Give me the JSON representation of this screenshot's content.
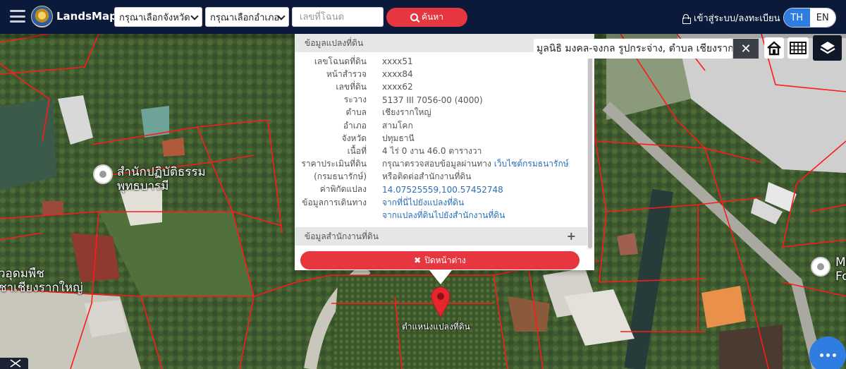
{
  "navbar": {
    "brand": "LandsMaps",
    "province_select": "กรุณาเลือกจังหวัด",
    "district_select": "กรุณาเลือกอำเภอ",
    "deed_placeholder": "เลขที่โฉนด",
    "search_label": "ค้นหา",
    "login_label": "เข้าสู่ระบบ/ลงทะเบียน",
    "lang_th": "TH",
    "lang_en": "EN"
  },
  "popup": {
    "header": "ข้อมูลแปลงที่ดิน",
    "rows": [
      {
        "label": "เลขโฉนดที่ดิน",
        "value": "xxxx51"
      },
      {
        "label": "หน้าสำรวจ",
        "value": "xxxx84"
      },
      {
        "label": "เลขที่ดิน",
        "value": "xxxx62"
      },
      {
        "label": "ระวาง",
        "value": "5137 III 7056-00 (4000)"
      },
      {
        "label": "ตำบล",
        "value": "เชียงรากใหญ่"
      },
      {
        "label": "อำเภอ",
        "value": "สามโคก"
      },
      {
        "label": "จังหวัด",
        "value": "ปทุมธานี"
      },
      {
        "label": "เนื้อที่",
        "value": "4 ไร่ 0 งาน 46.0 ตารางวา"
      }
    ],
    "appraisal_label": "ราคาประเมินที่ดิน",
    "appraisal_value": "กรุณาตรวจสอบข้อมูลผ่านทาง ",
    "appraisal_link": "เว็บไซต์กรมธนารักษ์",
    "treasury_label": "(กรมธนารักษ์)",
    "treasury_value": "หรือติดต่อสำนักงานที่ดิน",
    "coord_label": "ค่าพิกัดแปลง",
    "coord_value": "14.07525559,100.57452748",
    "travel_label": "ข้อมูลการเดินทาง",
    "travel_link_1": "จากที่นี่ไปยังแปลงที่ดิน",
    "travel_link_2": "จากแปลงที่ดินไปยังสำนักงานที่ดิน",
    "office_header": "ข้อมูลสำนักงานที่ดิน",
    "close_label": "ปิดหน้าต่าง"
  },
  "map": {
    "address_box": "มูลนิธิ มงคล-จงกล รูปกระจ่าง, ตำบล เชียงราก",
    "marker_label": "ตำแหน่งแปลงที่ดิน",
    "poi_1": {
      "line1": "สำนักปฏิบัติธรรม",
      "line2": "พุทธบารมี"
    },
    "poi_2": {
      "line1": "วอุดมพืช",
      "line2": "ชาเชียงรากใหญ่"
    },
    "poi_3": {
      "line1": "M",
      "line2": "Fo"
    }
  },
  "colors": {
    "navbar_bg": "#0b1a3a",
    "accent_red": "#e6363f",
    "accent_blue": "#2f7de1",
    "parcel_line": "#ff1a1a",
    "link": "#2a6fb8"
  }
}
